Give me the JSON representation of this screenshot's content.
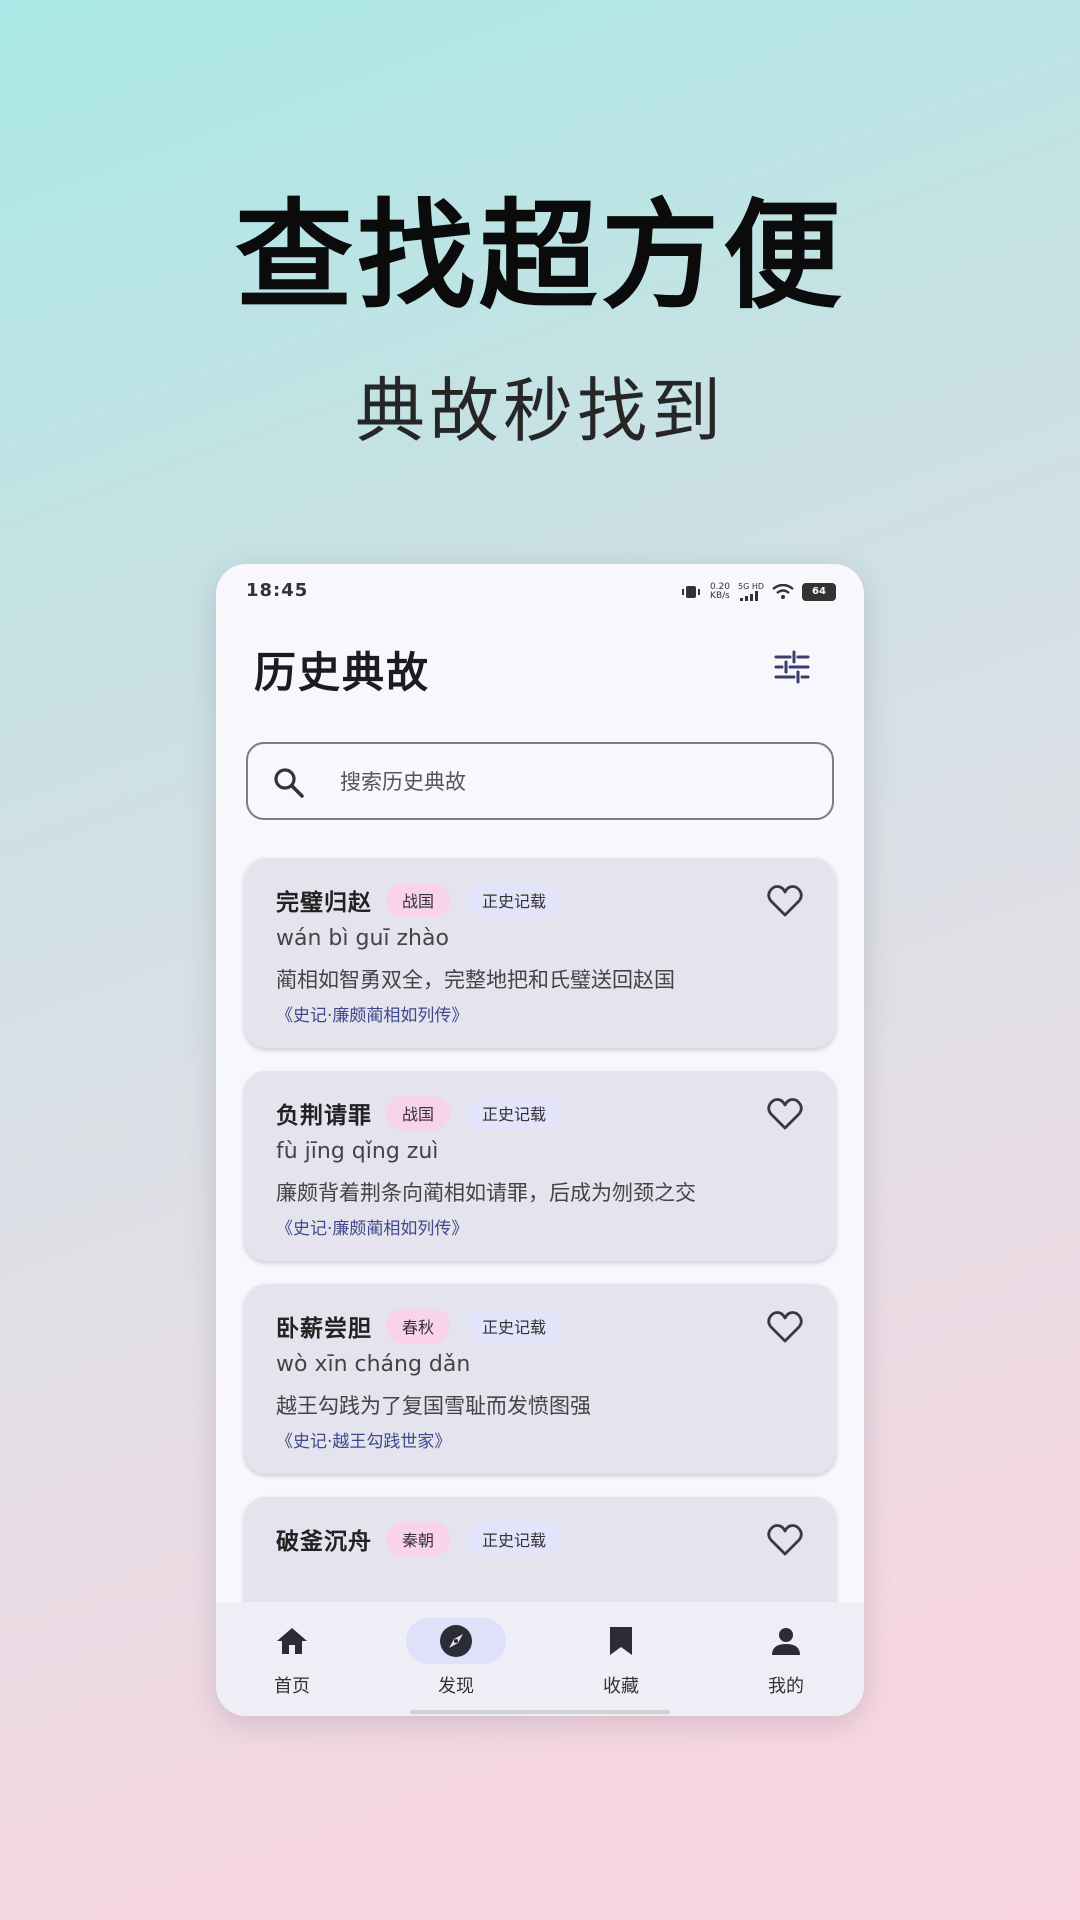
{
  "promo": {
    "title": "查找超方便",
    "subtitle": "典故秒找到"
  },
  "status_bar": {
    "time": "18:45",
    "net_speed_value": "0.20",
    "net_speed_unit": "KB/s",
    "network": "5G HD",
    "battery": "64"
  },
  "app": {
    "title": "历史典故"
  },
  "search": {
    "placeholder": "搜索历史典故"
  },
  "cards": [
    {
      "title": "完璧归赵",
      "era": "战国",
      "source_type": "正史记载",
      "pinyin": "wán bì guī zhào",
      "desc": "蔺相如智勇双全，完整地把和氏璧送回赵国",
      "source": "《史记·廉颇蔺相如列传》"
    },
    {
      "title": "负荆请罪",
      "era": "战国",
      "source_type": "正史记载",
      "pinyin": "fù jīng qǐng zuì",
      "desc": "廉颇背着荆条向蔺相如请罪，后成为刎颈之交",
      "source": "《史记·廉颇蔺相如列传》"
    },
    {
      "title": "卧薪尝胆",
      "era": "春秋",
      "source_type": "正史记载",
      "pinyin": "wò xīn cháng dǎn",
      "desc": "越王勾践为了复国雪耻而发愤图强",
      "source": "《史记·越王勾践世家》"
    },
    {
      "title": "破釜沉舟",
      "era": "秦朝",
      "source_type": "正史记载"
    }
  ],
  "nav": {
    "home": "首页",
    "discover": "发现",
    "favorites": "收藏",
    "mine": "我的"
  },
  "colors": {
    "era_tag": "#f9d2ec",
    "source_tag": "#e3e3f9",
    "card_bg": "#e5e3ee",
    "active_nav": "#dfe0fa"
  }
}
